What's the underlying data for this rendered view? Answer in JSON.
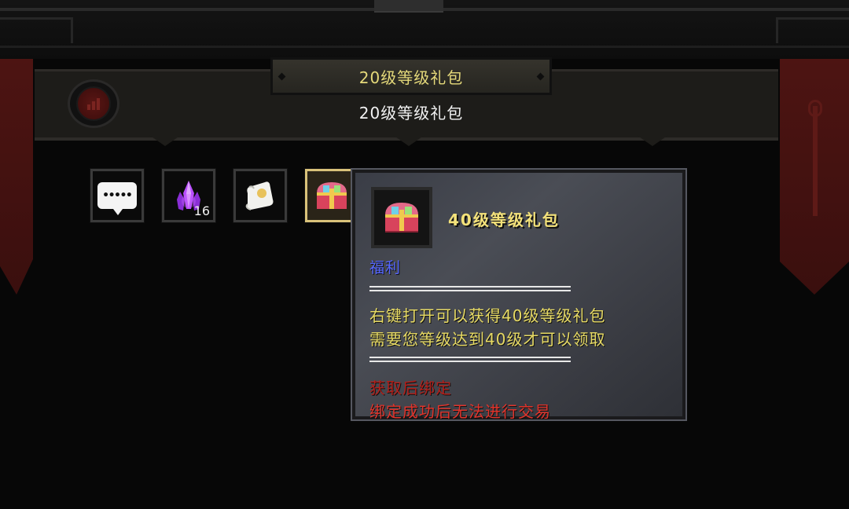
{
  "header": {
    "title": "20级等级礼包",
    "subtitle": "20级等级礼包"
  },
  "inventory": {
    "slots": [
      {
        "icon": "chat-bubble-icon",
        "label": "•••••"
      },
      {
        "icon": "purple-crystal-icon",
        "count": "16"
      },
      {
        "icon": "scroll-icon"
      },
      {
        "icon": "treasure-chest-icon",
        "selected": true
      }
    ]
  },
  "tooltip": {
    "item_name": "40级等级礼包",
    "category": "福利",
    "desc_line1": "右键打开可以获得40级等级礼包",
    "desc_line2": "需要您等级达到40级才可以领取",
    "bind_line1": "获取后绑定",
    "bind_line2": "绑定成功后无法进行交易"
  },
  "colors": {
    "item_name": "#f4e27a",
    "category": "#5566ff",
    "description": "#e7da64",
    "bind_warning_dark": "#b3201b",
    "bind_warning_light": "#e0342c",
    "banner_red": "#4d1412"
  }
}
